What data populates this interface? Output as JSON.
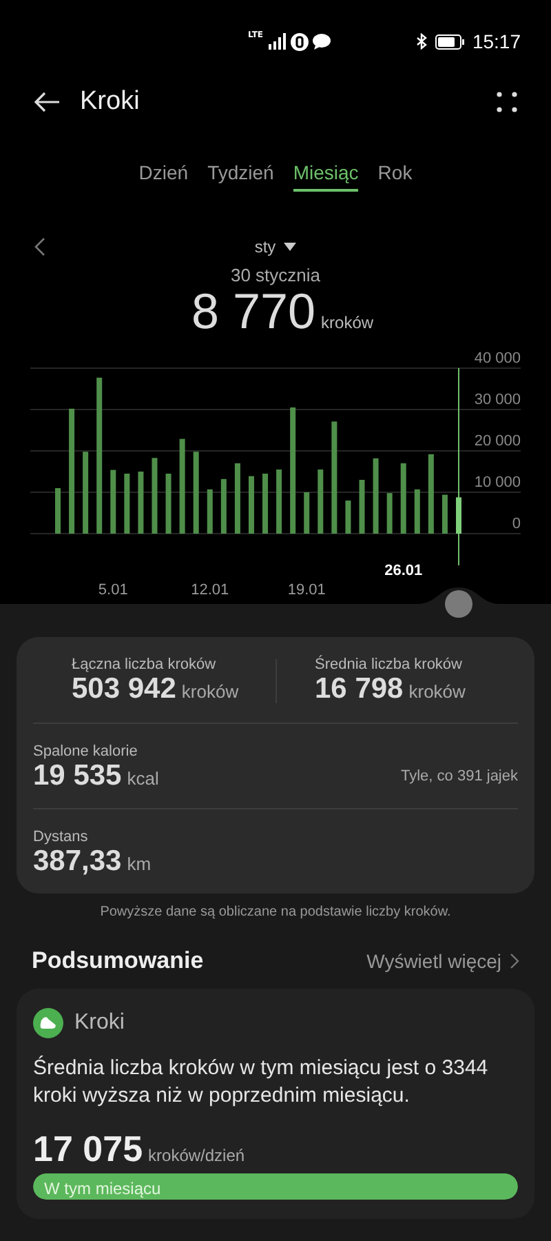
{
  "status_bar": {
    "time": "15:17",
    "network": "LTE"
  },
  "header": {
    "title": "Kroki"
  },
  "tabs": [
    {
      "label": "Dzień",
      "selected": false
    },
    {
      "label": "Tydzień",
      "selected": false
    },
    {
      "label": "Miesiąc",
      "selected": true
    },
    {
      "label": "Rok",
      "selected": false
    }
  ],
  "period": {
    "label": "sty"
  },
  "selected_day": {
    "date": "30 stycznia",
    "value": "8 770",
    "unit": "kroków"
  },
  "chart_data": {
    "type": "bar",
    "categories": [
      null,
      null,
      null,
      null,
      "5.01",
      null,
      null,
      null,
      null,
      null,
      null,
      "12.01",
      null,
      null,
      null,
      null,
      null,
      null,
      "19.01",
      null,
      null,
      null,
      null,
      null,
      null,
      "26.01",
      null,
      null,
      null,
      null
    ],
    "grid": true,
    "series": [
      {
        "color": "#4f8f4a",
        "values": [
          11000,
          30200,
          19800,
          37700,
          15400,
          14500,
          15000,
          18300,
          14500,
          22900,
          19800,
          10700,
          13200,
          17000,
          13900,
          14500,
          15500,
          30500,
          10000,
          15500,
          27100,
          8000,
          13000,
          18200,
          9800,
          17000,
          10700,
          19200,
          9400,
          null
        ]
      },
      {
        "color": "#7fd07a",
        "values": [
          null,
          null,
          null,
          null,
          null,
          null,
          null,
          null,
          null,
          null,
          null,
          null,
          null,
          null,
          null,
          null,
          null,
          null,
          null,
          null,
          null,
          null,
          null,
          null,
          null,
          null,
          null,
          null,
          null,
          8770
        ]
      }
    ],
    "ylim": [
      0,
      40000
    ],
    "yticks": [
      {
        "value": 0,
        "label": "0"
      },
      {
        "value": 10000,
        "label": "10 000"
      },
      {
        "value": 20000,
        "label": "20 000"
      },
      {
        "value": 30000,
        "label": "30 000"
      },
      {
        "value": 40000,
        "label": "40 000"
      }
    ]
  },
  "stats": {
    "top": [
      {
        "label": "Łączna liczba kroków",
        "value": "503 942",
        "unit": "kroków"
      },
      {
        "label": "Średnia liczba kroków",
        "value": "16 798",
        "unit": "kroków"
      }
    ],
    "rows": [
      {
        "label": "Spalone kalorie",
        "value": "19 535",
        "unit": "kcal",
        "note": "Tyle, co 391 jajek"
      },
      {
        "label": "Dystans",
        "value": "387,33",
        "unit": "km"
      }
    ]
  },
  "footnote": "Powyższe dane są obliczane na podstawie liczby kroków.",
  "summary": {
    "title": "Podsumowanie",
    "more": "Wyświetl więcej",
    "card": {
      "title": "Kroki",
      "text": "Średnia liczba kroków w tym miesiącu jest o 3344 kroki wyższa niż w poprzednim miesiącu.",
      "value": "17 075",
      "unit": "kroków/dzień",
      "bars": [
        {
          "label": "W tym miesiącu",
          "level": 1
        }
      ]
    }
  }
}
